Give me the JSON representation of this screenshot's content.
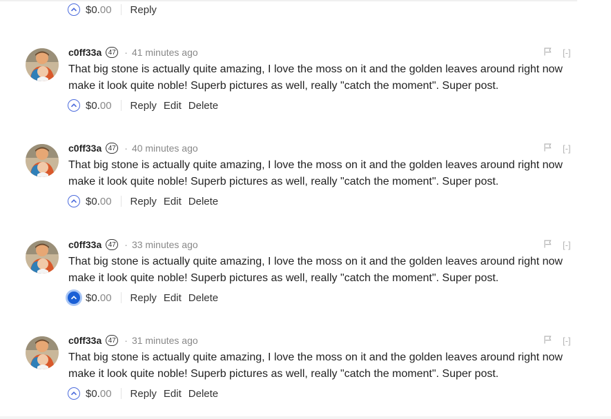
{
  "top_actions": {
    "payout_dollar": "$",
    "payout_whole": "0.",
    "payout_frac": "00",
    "reply": "Reply"
  },
  "comments": [
    {
      "author": "c0ff33a",
      "reputation": "47",
      "separator": "·",
      "time": "41 minutes ago",
      "body": "That big stone is actually quite amazing, I love the moss on it and the golden leaves around right now make it look quite noble! Superb pictures as well, really \"catch the moment\". Super post.",
      "payout_dollar": "$",
      "payout_whole": "0.",
      "payout_frac": "00",
      "reply": "Reply",
      "edit": "Edit",
      "delete": "Delete",
      "collapse": "[-]",
      "voted": false
    },
    {
      "author": "c0ff33a",
      "reputation": "47",
      "separator": "·",
      "time": "40 minutes ago",
      "body": "That big stone is actually quite amazing, I love the moss on it and the golden leaves around right now make it look quite noble! Superb pictures as well, really \"catch the moment\". Super post.",
      "payout_dollar": "$",
      "payout_whole": "0.",
      "payout_frac": "00",
      "reply": "Reply",
      "edit": "Edit",
      "delete": "Delete",
      "collapse": "[-]",
      "voted": false
    },
    {
      "author": "c0ff33a",
      "reputation": "47",
      "separator": "·",
      "time": "33 minutes ago",
      "body": "That big stone is actually quite amazing, I love the moss on it and the golden leaves around right now make it look quite noble! Superb pictures as well, really \"catch the moment\". Super post.",
      "payout_dollar": "$",
      "payout_whole": "0.",
      "payout_frac": "00",
      "reply": "Reply",
      "edit": "Edit",
      "delete": "Delete",
      "collapse": "[-]",
      "voted": true
    },
    {
      "author": "c0ff33a",
      "reputation": "47",
      "separator": "·",
      "time": "31 minutes ago",
      "body": "That big stone is actually quite amazing, I love the moss on it and the golden leaves around right now make it look quite noble! Superb pictures as well, really \"catch the moment\". Super post.",
      "payout_dollar": "$",
      "payout_whole": "0.",
      "payout_frac": "00",
      "reply": "Reply",
      "edit": "Edit",
      "delete": "Delete",
      "collapse": "[-]",
      "voted": false
    }
  ],
  "icons": {
    "upvote": "chevron-up-circle-icon",
    "flag": "flag-icon"
  },
  "colors": {
    "accent": "#1a5fd6",
    "upvote_outline": "#4b6bdc",
    "muted_text": "#888888",
    "flag_gray": "#b4b4b4"
  }
}
